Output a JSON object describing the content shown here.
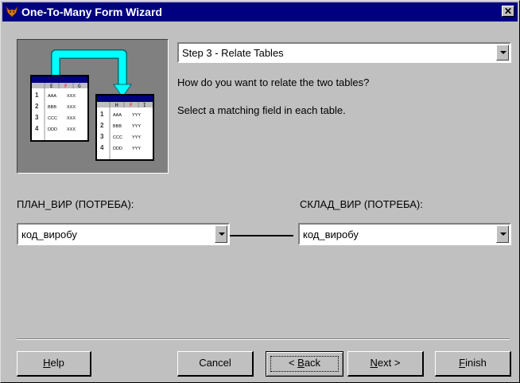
{
  "window": {
    "title": "One-To-Many Form Wizard",
    "close_glyph": "✕"
  },
  "step_select": {
    "value": "Step 3 - Relate Tables"
  },
  "instructions": {
    "question": "How do you want to relate the two tables?",
    "hint": "Select a matching field in each table."
  },
  "parent_table": {
    "label": "ПЛАН_ВИР (ПОТРЕБА):",
    "field": "код_виробу"
  },
  "child_table": {
    "label": "СКЛАД_ВИР (ПОТРЕБА):",
    "field": "код_виробу"
  },
  "illustration": {
    "left_table": {
      "headers": [
        "E",
        "F",
        "G"
      ],
      "rows": [
        [
          "1",
          "AAA",
          "XXX"
        ],
        [
          "2",
          "BBB",
          "XXX"
        ],
        [
          "3",
          "CCC",
          "XXX"
        ],
        [
          "4",
          "DDD",
          "XXX"
        ]
      ]
    },
    "right_table": {
      "headers": [
        "H",
        "F",
        "I"
      ],
      "rows": [
        [
          "1",
          "AAA",
          "YYY"
        ],
        [
          "2",
          "BBB",
          "YYY"
        ],
        [
          "3",
          "CCC",
          "YYY"
        ],
        [
          "4",
          "DDD",
          "YYY"
        ]
      ]
    },
    "arrow_color": "#00ffff",
    "highlight_color": "#ff0000"
  },
  "buttons": {
    "help": {
      "pre": "",
      "key": "H",
      "post": "elp"
    },
    "cancel": {
      "label": "Cancel"
    },
    "back": {
      "pre": "< ",
      "key": "B",
      "post": "ack"
    },
    "next": {
      "pre": "",
      "key": "N",
      "post": "ext >"
    },
    "finish": {
      "pre": "",
      "key": "F",
      "post": "inish"
    }
  }
}
